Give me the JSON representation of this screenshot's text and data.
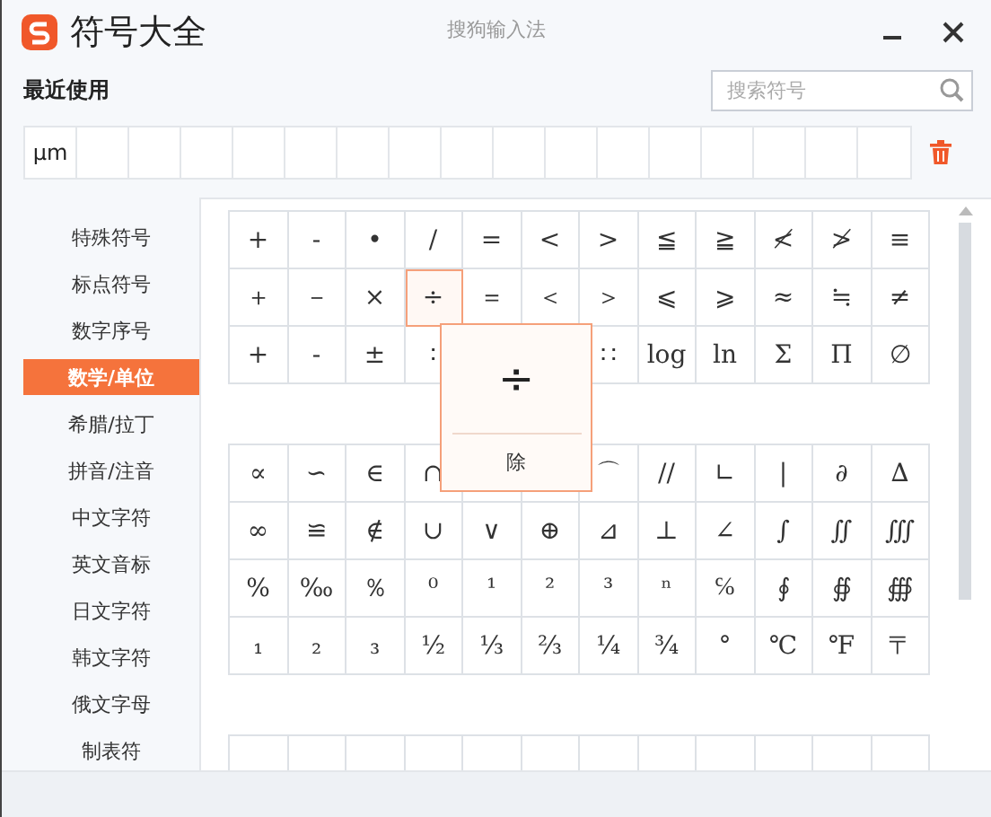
{
  "window": {
    "title": "符号大全",
    "subtitle": "搜狗输入法"
  },
  "recent": {
    "label": "最近使用",
    "items": [
      "µm"
    ]
  },
  "search": {
    "placeholder": "搜索符号"
  },
  "sidebar": {
    "items": [
      {
        "label": "特殊符号",
        "selected": false
      },
      {
        "label": "标点符号",
        "selected": false
      },
      {
        "label": "数字序号",
        "selected": false
      },
      {
        "label": "数学/单位",
        "selected": true
      },
      {
        "label": "希腊/拉丁",
        "selected": false
      },
      {
        "label": "拼音/注音",
        "selected": false
      },
      {
        "label": "中文字符",
        "selected": false
      },
      {
        "label": "英文音标",
        "selected": false
      },
      {
        "label": "日文字符",
        "selected": false
      },
      {
        "label": "韩文字符",
        "selected": false
      },
      {
        "label": "俄文字母",
        "selected": false
      },
      {
        "label": "制表符",
        "selected": false
      }
    ]
  },
  "grids": [
    {
      "rows": [
        [
          {
            "s": "+",
            "selected": false
          },
          {
            "s": "-",
            "selected": false
          },
          {
            "s": "•",
            "selected": false
          },
          {
            "s": "/",
            "selected": false
          },
          {
            "s": "=",
            "selected": false
          },
          {
            "s": "<",
            "selected": false
          },
          {
            "s": ">",
            "selected": false
          },
          {
            "s": "≦",
            "selected": false
          },
          {
            "s": "≧",
            "selected": false
          },
          {
            "s": "≮",
            "selected": false
          },
          {
            "s": "≯",
            "selected": false
          },
          {
            "s": "≡",
            "selected": false
          }
        ],
        [
          {
            "s": "＋",
            "selected": false
          },
          {
            "s": "－",
            "selected": false
          },
          {
            "s": "×",
            "selected": false
          },
          {
            "s": "÷",
            "selected": true
          },
          {
            "s": "＝",
            "selected": false
          },
          {
            "s": "＜",
            "selected": false
          },
          {
            "s": "＞",
            "selected": false
          },
          {
            "s": "⩽",
            "selected": false
          },
          {
            "s": "⩾",
            "selected": false
          },
          {
            "s": "≈",
            "selected": false
          },
          {
            "s": "≒",
            "selected": false
          },
          {
            "s": "≠",
            "selected": false
          }
        ],
        [
          {
            "s": "+",
            "selected": false
          },
          {
            "s": "-",
            "selected": false
          },
          {
            "s": "±",
            "selected": false
          },
          {
            "s": "∶",
            "selected": false
          },
          null,
          null,
          {
            "s": "∷",
            "selected": false
          },
          {
            "s": "log",
            "selected": false
          },
          {
            "s": "ln",
            "selected": false
          },
          {
            "s": "Σ",
            "selected": false
          },
          {
            "s": "Π",
            "selected": false
          },
          {
            "s": "∅",
            "selected": false
          }
        ]
      ]
    },
    {
      "rows": [
        [
          {
            "s": "∝",
            "selected": false
          },
          {
            "s": "∽",
            "selected": false
          },
          {
            "s": "∈",
            "selected": false
          },
          {
            "s": "∩",
            "selected": false
          },
          null,
          null,
          {
            "s": "⌒",
            "selected": false
          },
          {
            "s": "//",
            "selected": false
          },
          {
            "s": "∟",
            "selected": false
          },
          {
            "s": "|",
            "selected": false
          },
          {
            "s": "∂",
            "selected": false
          },
          {
            "s": "∆",
            "selected": false
          }
        ],
        [
          {
            "s": "∞",
            "selected": false
          },
          {
            "s": "≌",
            "selected": false
          },
          {
            "s": "∉",
            "selected": false
          },
          {
            "s": "∪",
            "selected": false
          },
          {
            "s": "∨",
            "selected": false
          },
          {
            "s": "⊕",
            "selected": false
          },
          {
            "s": "⊿",
            "selected": false
          },
          {
            "s": "⊥",
            "selected": false
          },
          {
            "s": "∠",
            "selected": false
          },
          {
            "s": "∫",
            "selected": false
          },
          {
            "s": "∬",
            "selected": false
          },
          {
            "s": "∭",
            "selected": false
          }
        ],
        [
          {
            "s": "%",
            "selected": false
          },
          {
            "s": "‰",
            "selected": false
          },
          {
            "s": "％",
            "selected": false
          },
          {
            "s": "⁰",
            "selected": false
          },
          {
            "s": "¹",
            "selected": false
          },
          {
            "s": "²",
            "selected": false
          },
          {
            "s": "³",
            "selected": false
          },
          {
            "s": "ⁿ",
            "selected": false
          },
          {
            "s": "℅",
            "selected": false
          },
          {
            "s": "∮",
            "selected": false
          },
          {
            "s": "∯",
            "selected": false
          },
          {
            "s": "∰",
            "selected": false
          }
        ],
        [
          {
            "s": "₁",
            "selected": false
          },
          {
            "s": "₂",
            "selected": false
          },
          {
            "s": "₃",
            "selected": false
          },
          {
            "s": "½",
            "selected": false
          },
          {
            "s": "⅓",
            "selected": false
          },
          {
            "s": "⅔",
            "selected": false
          },
          {
            "s": "¼",
            "selected": false
          },
          {
            "s": "¾",
            "selected": false
          },
          {
            "s": "°",
            "selected": false
          },
          {
            "s": "℃",
            "selected": false
          },
          {
            "s": "℉",
            "selected": false
          },
          {
            "s": "〒",
            "selected": false
          }
        ]
      ]
    }
  ],
  "popup": {
    "symbol": "÷",
    "description": "除"
  }
}
